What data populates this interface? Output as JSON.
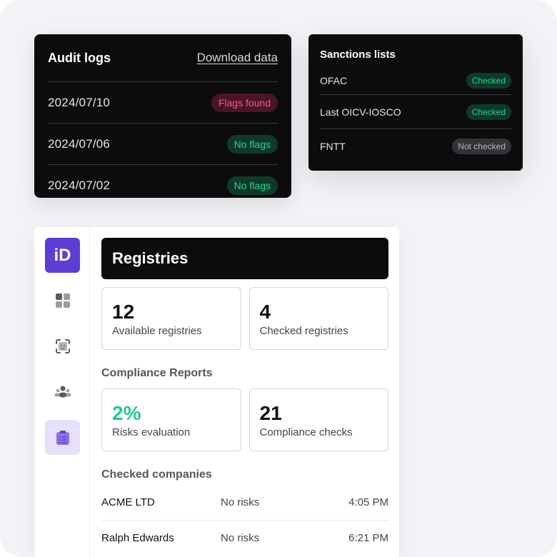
{
  "audit": {
    "title": "Audit logs",
    "link": "Download data",
    "rows": [
      {
        "date": "2024/07/10",
        "status": "Flags found"
      },
      {
        "date": "2024/07/06",
        "status": "No flags"
      },
      {
        "date": "2024/07/02",
        "status": "No flags"
      }
    ]
  },
  "sanctions": {
    "title": "Sanctions lists",
    "rows": [
      {
        "name": "OFAC",
        "status": "Checked"
      },
      {
        "name": "Last OICV-IOSCO",
        "status": "Checked"
      },
      {
        "name": "FNTT",
        "status": "Not checked"
      }
    ]
  },
  "app": {
    "logo": "iD",
    "nav": [
      "grid-icon",
      "face-scan-icon",
      "people-icon",
      "clipboard-icon"
    ],
    "registries": {
      "title": "Registries",
      "stats": [
        {
          "value": "12",
          "label": "Available registries"
        },
        {
          "value": "4",
          "label": "Checked registries"
        }
      ]
    },
    "compliance": {
      "title": "Compliance Reports",
      "stats": [
        {
          "value": "2%",
          "label": "Risks evaluation"
        },
        {
          "value": "21",
          "label": "Compliance checks"
        }
      ]
    },
    "companies": {
      "title": "Checked companies",
      "rows": [
        {
          "name": "ACME LTD",
          "risk": "No risks",
          "time": "4:05 PM"
        },
        {
          "name": "Ralph Edwards",
          "risk": "No risks",
          "time": "6:21 PM"
        }
      ]
    }
  },
  "colors": {
    "accent": "#5b3fd4",
    "accent_light": "#e6e0fb",
    "success": "#24c98a",
    "danger": "#f2568a"
  }
}
